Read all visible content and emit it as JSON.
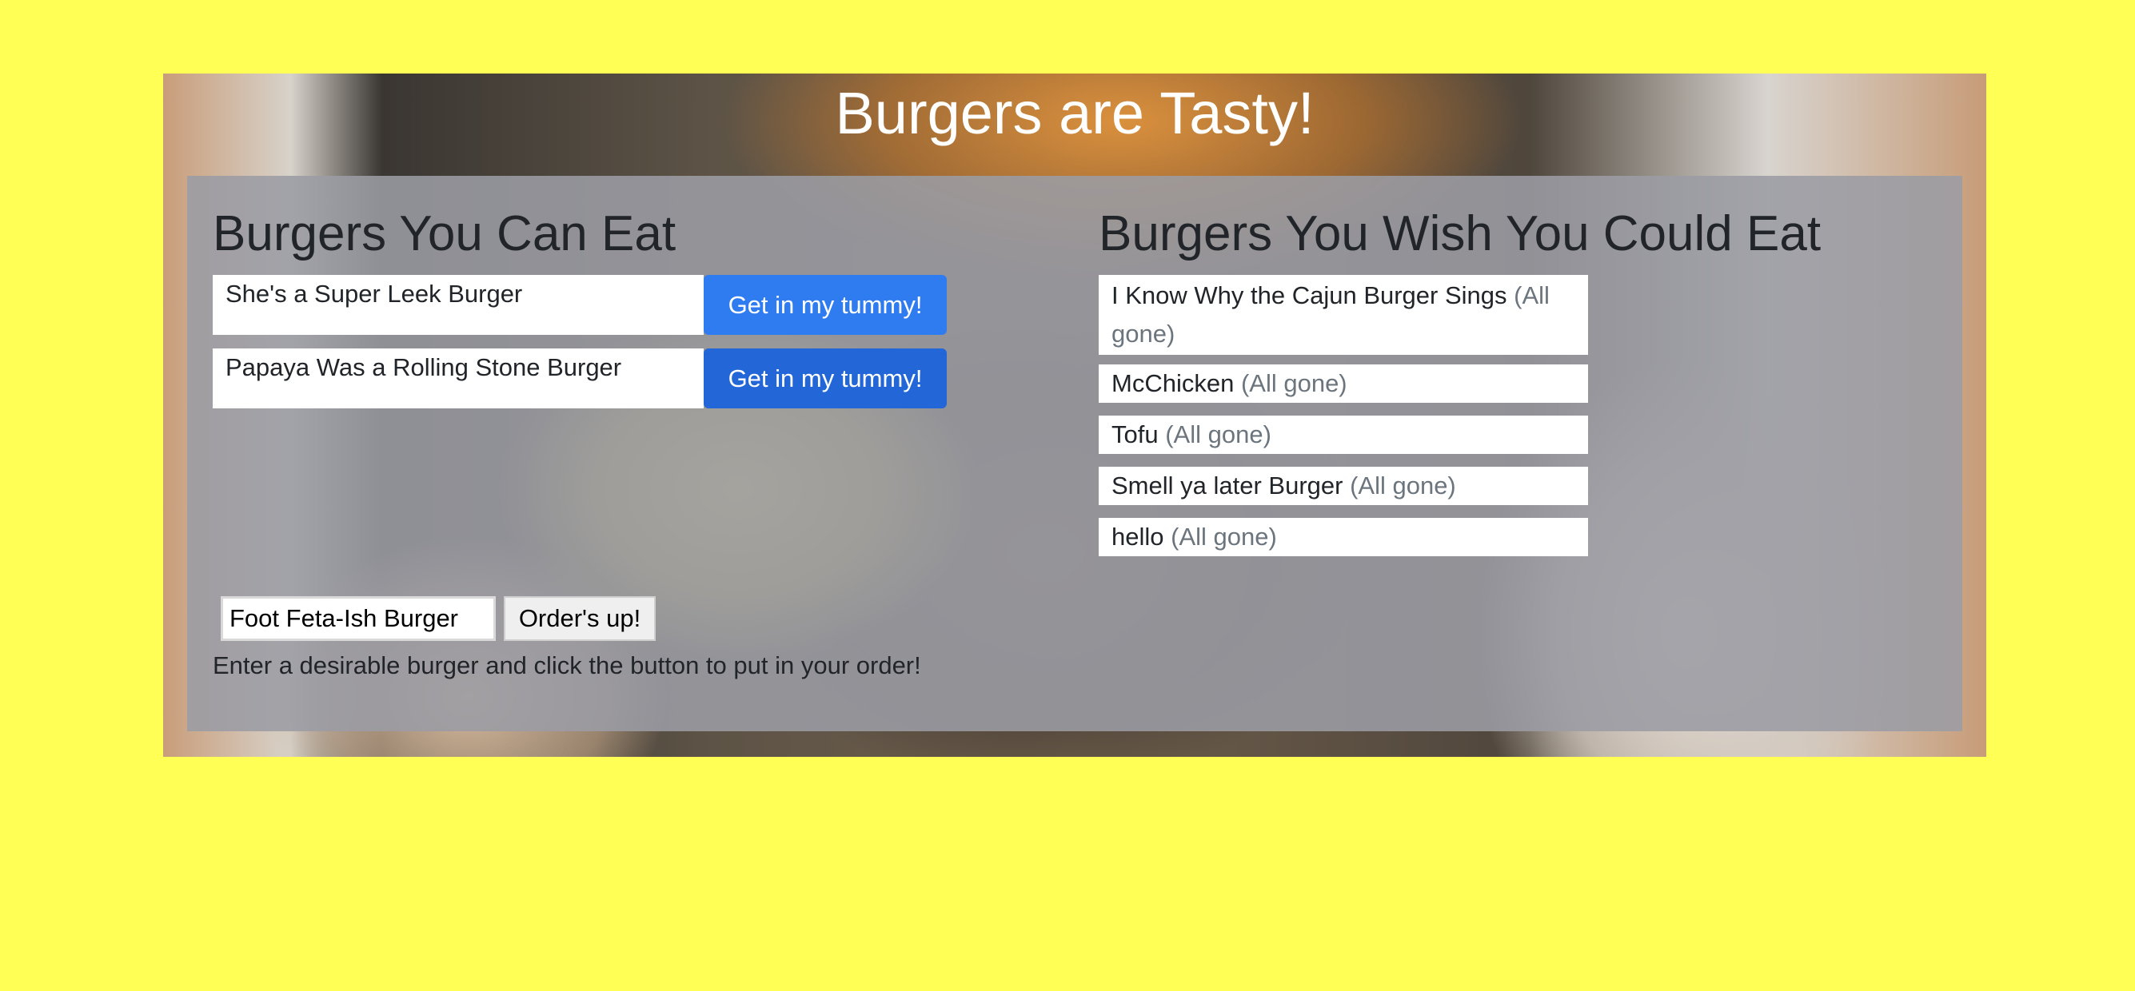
{
  "header": {
    "title": "Burgers are Tasty!"
  },
  "can_eat": {
    "heading": "Burgers You Can Eat",
    "items": [
      {
        "name": "She's a Super Leek Burger",
        "button_label": "Get in my tummy!"
      },
      {
        "name": "Papaya Was a Rolling Stone Burger",
        "button_label": "Get in my tummy!"
      }
    ]
  },
  "wish_eat": {
    "heading": "Burgers You Wish You Could Eat",
    "status_label": "(All gone)",
    "items": [
      {
        "name": "I Know Why the Cajun Burger Sings"
      },
      {
        "name": "McChicken"
      },
      {
        "name": "Tofu"
      },
      {
        "name": "Smell ya later Burger"
      },
      {
        "name": "hello"
      }
    ]
  },
  "order_form": {
    "input_value": "Foot Feta-Ish Burger",
    "button_label": "Order's up!",
    "help_text": "Enter a desirable burger and click the button to put in your order!"
  },
  "colors": {
    "page_background": "#ffff55",
    "primary_button": "#2f7bf0",
    "panel_overlay": "#9b9ca4"
  }
}
